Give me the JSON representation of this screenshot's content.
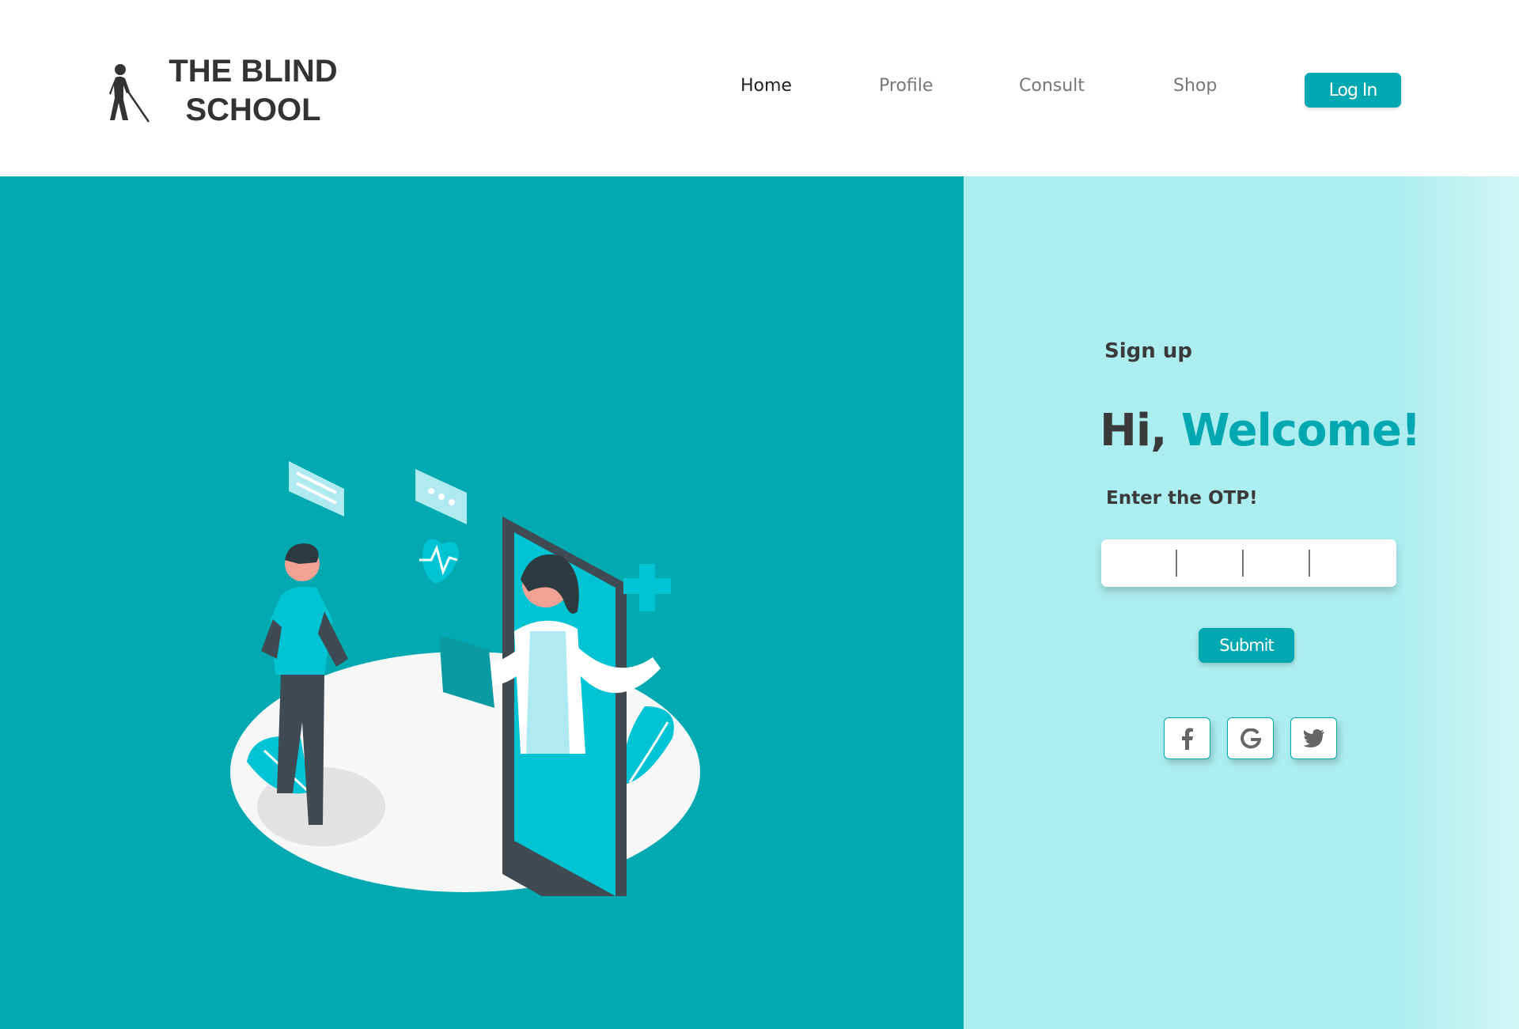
{
  "brand": {
    "line1": "THE BLIND",
    "line2": "SCHOOL",
    "icon": "blind-person-with-cane-icon"
  },
  "nav": {
    "items": [
      {
        "label": "Home",
        "active": true
      },
      {
        "label": "Profile",
        "active": false
      },
      {
        "label": "Consult",
        "active": false
      },
      {
        "label": "Shop",
        "active": false
      }
    ],
    "login_label": "Log In"
  },
  "form": {
    "title": "Sign up",
    "greeting_prefix": "Hi,",
    "greeting_accent": "Welcome!",
    "otp_label": "Enter the OTP!",
    "otp_digits": [
      "",
      "",
      "",
      ""
    ],
    "submit_label": "Submit"
  },
  "social": [
    {
      "name": "facebook",
      "icon": "facebook-icon"
    },
    {
      "name": "google",
      "icon": "google-icon"
    },
    {
      "name": "twitter",
      "icon": "twitter-icon"
    }
  ],
  "illustration": {
    "subject": "telemedicine-doctor-on-phone"
  },
  "colors": {
    "accent": "#02a8b1",
    "panel": "#acedef",
    "text": "#3a3a3a"
  }
}
